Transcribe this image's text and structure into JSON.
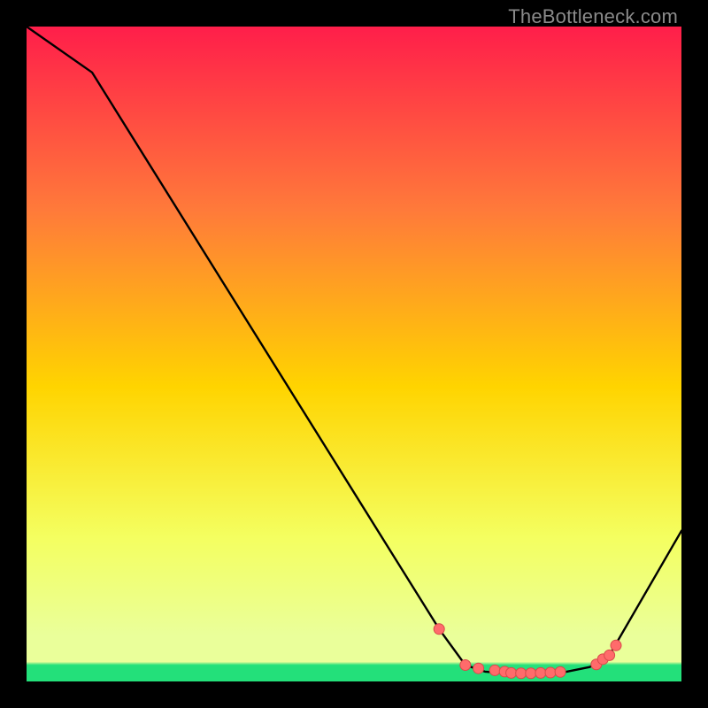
{
  "watermark": "TheBottleneck.com",
  "colors": {
    "bg_top": "#ff1e4a",
    "bg_mid_upper": "#ff7a3a",
    "bg_mid": "#ffd400",
    "bg_lower": "#f4ff60",
    "bg_bottom_yellow": "#eaff9a",
    "bg_green": "#23e07a",
    "line": "#000000",
    "marker_fill": "#ff6b6b",
    "marker_stroke": "#d84a4a",
    "frame": "#000000"
  },
  "chart_data": {
    "type": "line",
    "title": "",
    "xlabel": "",
    "ylabel": "",
    "xlim": [
      0,
      100
    ],
    "ylim": [
      0,
      100
    ],
    "series": [
      {
        "name": "curve",
        "x": [
          0,
          10,
          63,
          67,
          70,
          74,
          78,
          82,
          86,
          89,
          100
        ],
        "y": [
          100,
          93,
          8,
          2.5,
          1.5,
          1.2,
          1.2,
          1.4,
          2.2,
          4,
          23
        ]
      }
    ],
    "markers": {
      "name": "highlighted-points",
      "x": [
        63,
        67,
        69,
        71.5,
        73,
        74,
        75.5,
        77,
        78.5,
        80,
        81.5,
        87,
        88,
        89,
        90
      ],
      "y": [
        8,
        2.5,
        2.0,
        1.7,
        1.5,
        1.3,
        1.25,
        1.25,
        1.3,
        1.35,
        1.45,
        2.6,
        3.4,
        4.0,
        5.5
      ]
    }
  }
}
